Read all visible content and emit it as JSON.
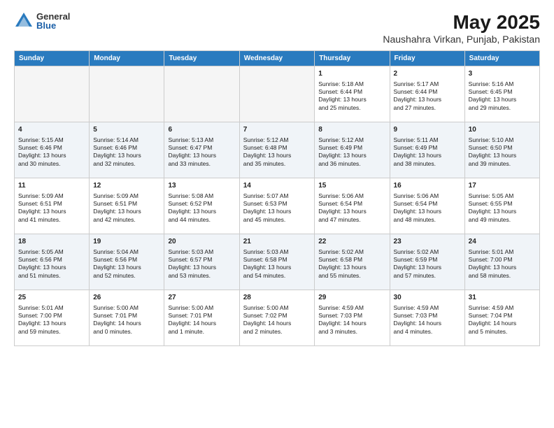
{
  "logo": {
    "general": "General",
    "blue": "Blue"
  },
  "title": "May 2025",
  "subtitle": "Naushahra Virkan, Punjab, Pakistan",
  "headers": [
    "Sunday",
    "Monday",
    "Tuesday",
    "Wednesday",
    "Thursday",
    "Friday",
    "Saturday"
  ],
  "weeks": [
    [
      {
        "day": "",
        "info": ""
      },
      {
        "day": "",
        "info": ""
      },
      {
        "day": "",
        "info": ""
      },
      {
        "day": "",
        "info": ""
      },
      {
        "day": "1",
        "info": "Sunrise: 5:18 AM\nSunset: 6:44 PM\nDaylight: 13 hours\nand 25 minutes."
      },
      {
        "day": "2",
        "info": "Sunrise: 5:17 AM\nSunset: 6:44 PM\nDaylight: 13 hours\nand 27 minutes."
      },
      {
        "day": "3",
        "info": "Sunrise: 5:16 AM\nSunset: 6:45 PM\nDaylight: 13 hours\nand 29 minutes."
      }
    ],
    [
      {
        "day": "4",
        "info": "Sunrise: 5:15 AM\nSunset: 6:46 PM\nDaylight: 13 hours\nand 30 minutes."
      },
      {
        "day": "5",
        "info": "Sunrise: 5:14 AM\nSunset: 6:46 PM\nDaylight: 13 hours\nand 32 minutes."
      },
      {
        "day": "6",
        "info": "Sunrise: 5:13 AM\nSunset: 6:47 PM\nDaylight: 13 hours\nand 33 minutes."
      },
      {
        "day": "7",
        "info": "Sunrise: 5:12 AM\nSunset: 6:48 PM\nDaylight: 13 hours\nand 35 minutes."
      },
      {
        "day": "8",
        "info": "Sunrise: 5:12 AM\nSunset: 6:49 PM\nDaylight: 13 hours\nand 36 minutes."
      },
      {
        "day": "9",
        "info": "Sunrise: 5:11 AM\nSunset: 6:49 PM\nDaylight: 13 hours\nand 38 minutes."
      },
      {
        "day": "10",
        "info": "Sunrise: 5:10 AM\nSunset: 6:50 PM\nDaylight: 13 hours\nand 39 minutes."
      }
    ],
    [
      {
        "day": "11",
        "info": "Sunrise: 5:09 AM\nSunset: 6:51 PM\nDaylight: 13 hours\nand 41 minutes."
      },
      {
        "day": "12",
        "info": "Sunrise: 5:09 AM\nSunset: 6:51 PM\nDaylight: 13 hours\nand 42 minutes."
      },
      {
        "day": "13",
        "info": "Sunrise: 5:08 AM\nSunset: 6:52 PM\nDaylight: 13 hours\nand 44 minutes."
      },
      {
        "day": "14",
        "info": "Sunrise: 5:07 AM\nSunset: 6:53 PM\nDaylight: 13 hours\nand 45 minutes."
      },
      {
        "day": "15",
        "info": "Sunrise: 5:06 AM\nSunset: 6:54 PM\nDaylight: 13 hours\nand 47 minutes."
      },
      {
        "day": "16",
        "info": "Sunrise: 5:06 AM\nSunset: 6:54 PM\nDaylight: 13 hours\nand 48 minutes."
      },
      {
        "day": "17",
        "info": "Sunrise: 5:05 AM\nSunset: 6:55 PM\nDaylight: 13 hours\nand 49 minutes."
      }
    ],
    [
      {
        "day": "18",
        "info": "Sunrise: 5:05 AM\nSunset: 6:56 PM\nDaylight: 13 hours\nand 51 minutes."
      },
      {
        "day": "19",
        "info": "Sunrise: 5:04 AM\nSunset: 6:56 PM\nDaylight: 13 hours\nand 52 minutes."
      },
      {
        "day": "20",
        "info": "Sunrise: 5:03 AM\nSunset: 6:57 PM\nDaylight: 13 hours\nand 53 minutes."
      },
      {
        "day": "21",
        "info": "Sunrise: 5:03 AM\nSunset: 6:58 PM\nDaylight: 13 hours\nand 54 minutes."
      },
      {
        "day": "22",
        "info": "Sunrise: 5:02 AM\nSunset: 6:58 PM\nDaylight: 13 hours\nand 55 minutes."
      },
      {
        "day": "23",
        "info": "Sunrise: 5:02 AM\nSunset: 6:59 PM\nDaylight: 13 hours\nand 57 minutes."
      },
      {
        "day": "24",
        "info": "Sunrise: 5:01 AM\nSunset: 7:00 PM\nDaylight: 13 hours\nand 58 minutes."
      }
    ],
    [
      {
        "day": "25",
        "info": "Sunrise: 5:01 AM\nSunset: 7:00 PM\nDaylight: 13 hours\nand 59 minutes."
      },
      {
        "day": "26",
        "info": "Sunrise: 5:00 AM\nSunset: 7:01 PM\nDaylight: 14 hours\nand 0 minutes."
      },
      {
        "day": "27",
        "info": "Sunrise: 5:00 AM\nSunset: 7:01 PM\nDaylight: 14 hours\nand 1 minute."
      },
      {
        "day": "28",
        "info": "Sunrise: 5:00 AM\nSunset: 7:02 PM\nDaylight: 14 hours\nand 2 minutes."
      },
      {
        "day": "29",
        "info": "Sunrise: 4:59 AM\nSunset: 7:03 PM\nDaylight: 14 hours\nand 3 minutes."
      },
      {
        "day": "30",
        "info": "Sunrise: 4:59 AM\nSunset: 7:03 PM\nDaylight: 14 hours\nand 4 minutes."
      },
      {
        "day": "31",
        "info": "Sunrise: 4:59 AM\nSunset: 7:04 PM\nDaylight: 14 hours\nand 5 minutes."
      }
    ]
  ]
}
